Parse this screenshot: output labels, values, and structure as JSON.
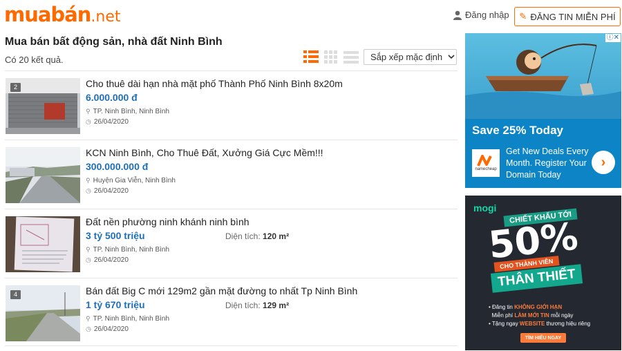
{
  "header": {
    "logo_main": "muabán",
    "logo_tld": ".net",
    "login_label": "Đăng nhập",
    "post_button_label": "ĐĂNG TIN MIỄN PHÍ"
  },
  "main": {
    "page_title": "Mua bán bất động sản, nhà đất Ninh Bình",
    "result_count": "Có 20 kết quả.",
    "sort_label": "Sắp xếp mặc định",
    "view_modes": [
      "list",
      "grid",
      "compact"
    ],
    "active_view": "list"
  },
  "listings": [
    {
      "title": "Cho thuê dài hạn nhà mặt phố Thành Phố Ninh Bình 8x20m",
      "price": "6.000.000 đ",
      "area_label": "",
      "area_value": "",
      "location": "TP. Ninh Bình, Ninh Bình",
      "date": "26/04/2020",
      "photo_count": "2"
    },
    {
      "title": "KCN Ninh Bình, Cho Thuê Đất, Xưởng Giá Cực Mềm!!!",
      "price": "300.000.000 đ",
      "area_label": "",
      "area_value": "",
      "location": "Huyện Gia Viễn, Ninh Bình",
      "date": "26/04/2020",
      "photo_count": ""
    },
    {
      "title": "Đất nền phường ninh khánh ninh bình",
      "price": "3 tỷ 500 triệu",
      "area_label": "Diện tích:",
      "area_value": "120 m²",
      "location": "TP. Ninh Bình, Ninh Bình",
      "date": "26/04/2020",
      "photo_count": ""
    },
    {
      "title": "Bán đất Big C mới 129m2 gần mặt đường to nhất Tp Ninh Bình",
      "price": "1 tỷ 670 triệu",
      "area_label": "Diện tích:",
      "area_value": "129 m²",
      "location": "TP. Ninh Bình, Ninh Bình",
      "date": "26/04/2020",
      "photo_count": "4"
    }
  ],
  "ads": {
    "namecheap": {
      "headline": "Save 25% Today",
      "body": "Get New Deals Every Month. Register Your Domain Today",
      "brand": "namecheap",
      "adchoices": "ⓘ✕"
    },
    "mogi": {
      "brand": "mogi",
      "ribbon": "CHIẾT KHẤU TỚI",
      "big": "50%",
      "sub_ribbon": "CHO THÀNH VIÊN",
      "banner": "THÂN THIẾT",
      "bullet1_pre": "Đăng tin ",
      "bullet1_hl": "KHÔNG GIỚI HẠN",
      "bullet2_pre": "Miễn phí ",
      "bullet2_hl": "LÀM MỚI TIN",
      "bullet2_post": " mỗi ngày",
      "bullet3_pre": "Tặng ngay ",
      "bullet3_hl": "WEBSITE",
      "bullet3_post": " thương hiệu riêng",
      "cta": "TÌM HIỂU NGAY"
    }
  },
  "colors": {
    "brand_orange": "#ff6a00",
    "price_blue": "#1d6fb8"
  }
}
